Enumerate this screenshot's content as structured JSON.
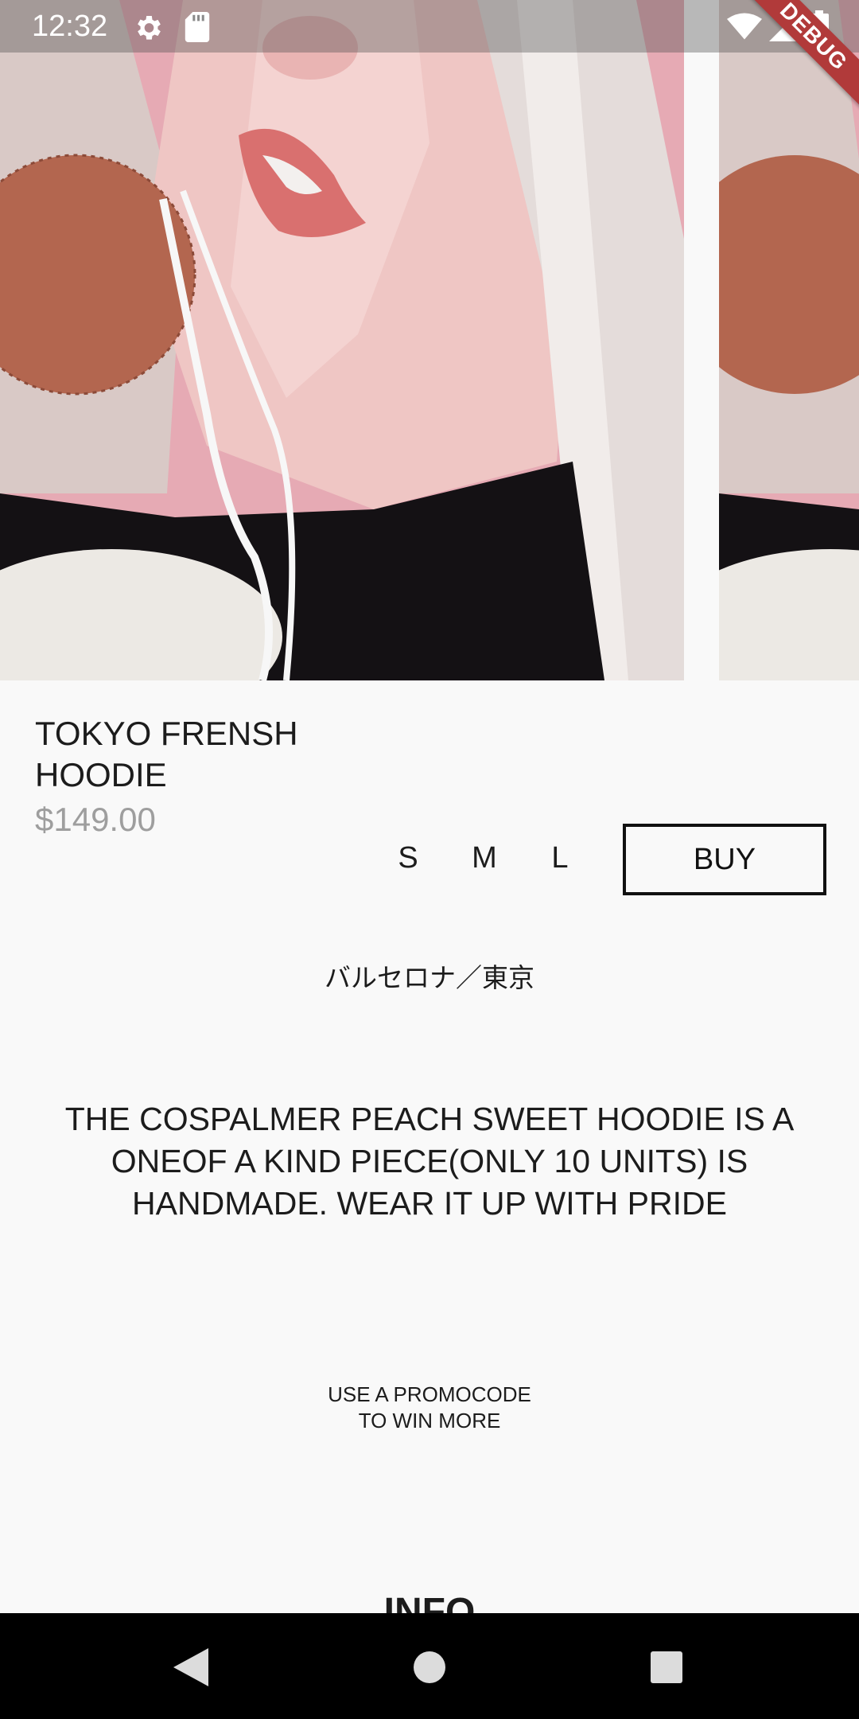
{
  "status_bar": {
    "time": "12:32",
    "icons": [
      "gear-icon",
      "sd-card-icon",
      "wifi-icon",
      "cell-signal-icon",
      "battery-icon"
    ]
  },
  "debug_banner": "DEBUG",
  "product": {
    "title": "TOKYO FRENSH HOODIE",
    "price": "$149.00",
    "sizes": [
      "S",
      "M",
      "L"
    ],
    "buy_label": "BUY",
    "origin": "バルセロナ／東京",
    "description": "THE COSPALMER PEACH SWEET HOODIE IS A ONEOF A KIND PIECE(ONLY 10 UNITS) IS HANDMADE. WEAR IT UP WITH PRIDE",
    "promo_line1": "USE A PROMOCODE",
    "promo_line2": "TO WIN MORE",
    "info_heading": "INFO"
  },
  "nav_bar": {
    "icons": [
      "back-triangle-icon",
      "home-circle-icon",
      "recents-square-icon"
    ]
  },
  "colors": {
    "background": "#f9f9f9",
    "text": "#1c1c1c",
    "price": "#9e9e9e",
    "image_backdrop_pink": "#e4a9b2",
    "debug_ribbon": "#b13a3a"
  }
}
